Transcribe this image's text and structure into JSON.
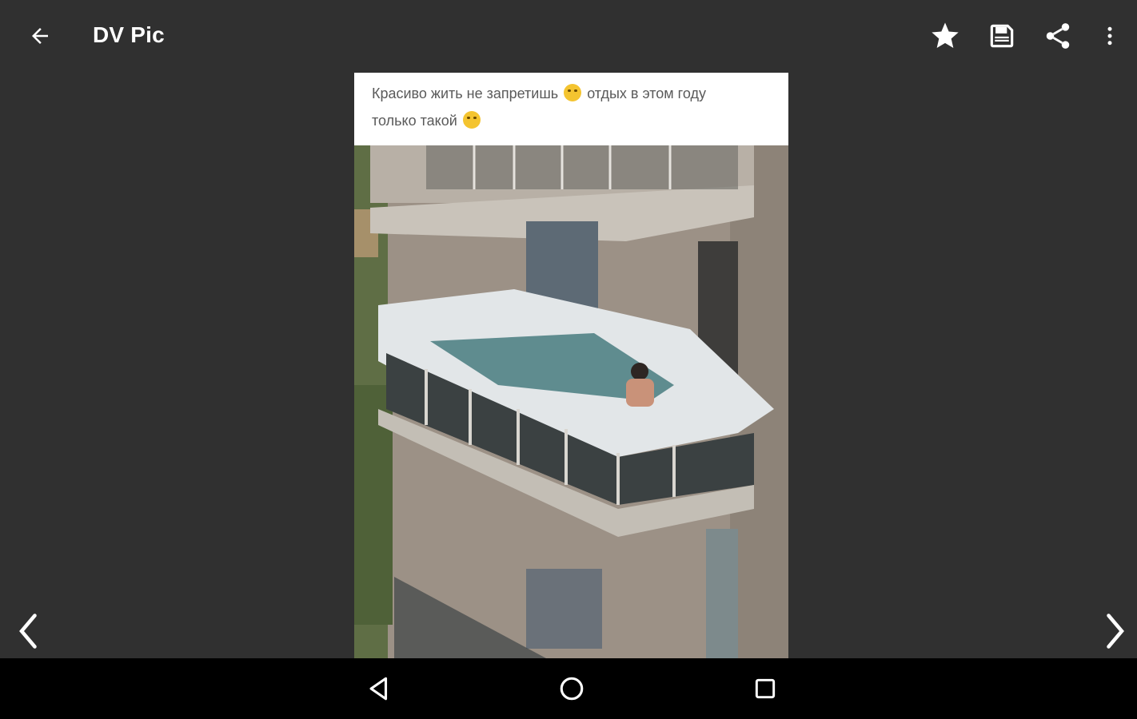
{
  "app": {
    "title": "DV Pic"
  },
  "toolbar": {
    "icons": [
      "back-arrow-icon",
      "star-icon",
      "save-icon",
      "share-icon",
      "more-vert-icon"
    ],
    "icon_color": "#ffffff"
  },
  "post": {
    "caption_line1_a": "Красиво жить не запретишь",
    "caption_line1_b": "отдых в этом году",
    "caption_line2": "только такой",
    "emojis": [
      "grinning-face",
      "grinning-face"
    ]
  },
  "navigation": {
    "prev_icon": "chevron-left-icon",
    "next_icon": "chevron-right-icon"
  },
  "system_nav": {
    "buttons": [
      "back-triangle-icon",
      "home-circle-icon",
      "recents-square-icon"
    ]
  },
  "colors": {
    "background": "#303030",
    "system_bar": "#000000",
    "caption_bg": "#ffffff"
  }
}
